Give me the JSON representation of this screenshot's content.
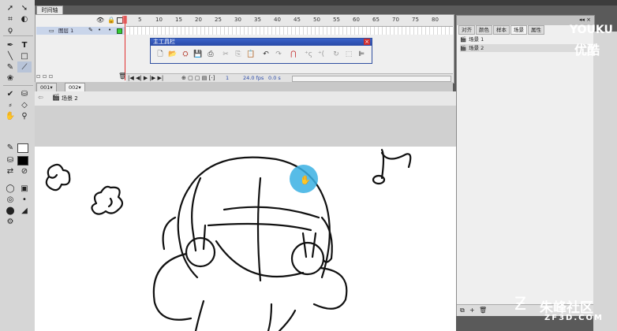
{
  "timeline": {
    "tab_label": "时间轴",
    "ruler_numbers": [
      "5",
      "10",
      "15",
      "20",
      "25",
      "30",
      "35",
      "40",
      "45",
      "50",
      "55",
      "60",
      "65",
      "70",
      "75",
      "80"
    ],
    "layer_name": "图层 1",
    "fps": "24.0 fps",
    "elapsed": "0.0 s",
    "frame": "1"
  },
  "main_toolbar": {
    "title": "主工具栏",
    "close": "×",
    "buttons": [
      "new-icon",
      "open-icon",
      "bridge-icon",
      "save-icon",
      "print-icon",
      "cut-icon",
      "copy-icon",
      "paste-icon",
      "undo-icon",
      "redo-icon",
      "snap-icon",
      "smooth-icon",
      "straighten-icon",
      "rotate-icon",
      "scale-icon",
      "align-icon"
    ]
  },
  "doc_tabs": [
    "001▾",
    "002▾"
  ],
  "scene_bar": {
    "scene": "场景 2"
  },
  "panel": {
    "tabs": [
      "对齐",
      "颜色",
      "样本",
      "场景",
      "属性"
    ],
    "active_tab": "场景",
    "scenes": [
      "场景 1",
      "场景 2"
    ],
    "title_buttons": "◂◂ ×"
  },
  "watermarks": {
    "youku_en": "YOUKU",
    "youku_cn": "优酷",
    "brand_cn": "朱峰社区",
    "brand_url": "ZF3D.COM"
  },
  "colors": {
    "selection": "#39b0e3",
    "accent": "#2a4aa8"
  }
}
